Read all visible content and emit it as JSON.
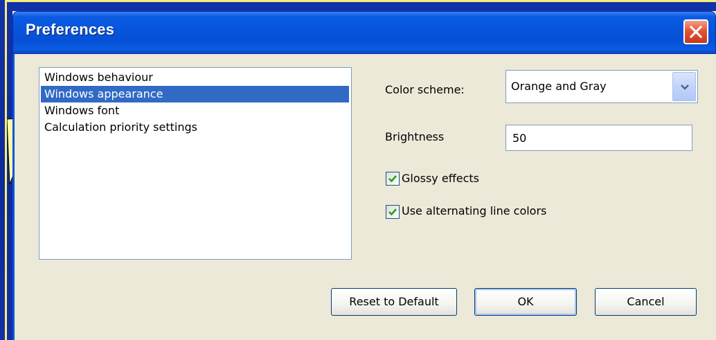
{
  "window": {
    "title": "Preferences"
  },
  "list": {
    "items": [
      {
        "label": "Windows behaviour",
        "selected": false
      },
      {
        "label": "Windows appearance",
        "selected": true
      },
      {
        "label": "Windows font",
        "selected": false
      },
      {
        "label": "Calculation priority settings",
        "selected": false
      }
    ]
  },
  "settings": {
    "color_scheme_label": "Color scheme:",
    "color_scheme_value": "Orange and Gray",
    "brightness_label": "Brightness",
    "brightness_value": "50",
    "glossy_label": "Glossy effects",
    "glossy_checked": true,
    "alt_lines_label": "Use alternating line colors",
    "alt_lines_checked": true
  },
  "buttons": {
    "reset_label": "Reset to Default",
    "ok_label": "OK",
    "cancel_label": "Cancel"
  },
  "icons": {
    "close": "close-icon",
    "dropdown": "chevron-down-icon",
    "check": "checkmark-icon"
  },
  "colors": {
    "titlebar": "#0855dd",
    "selection": "#316ac5",
    "dialog_bg": "#ece9d8",
    "callout": "#fff8a8"
  }
}
